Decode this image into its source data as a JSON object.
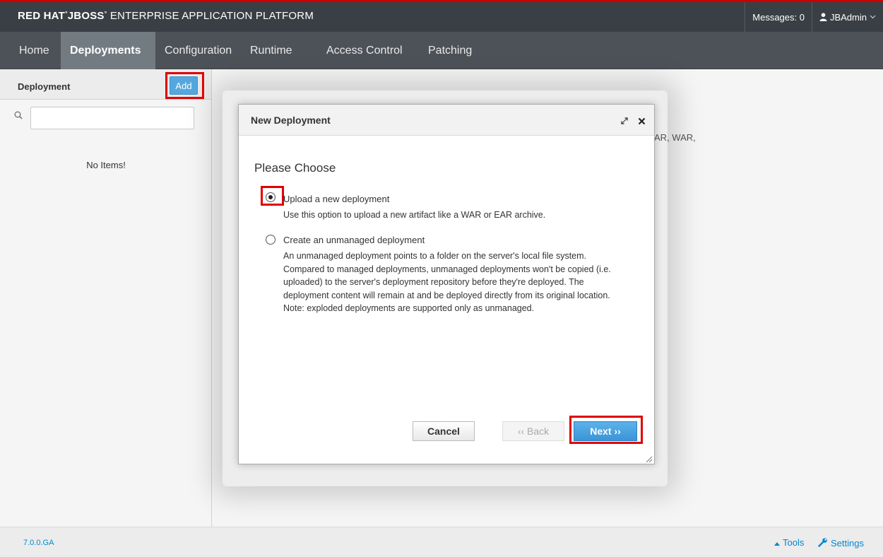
{
  "header": {
    "brand_part1": "RED HAT",
    "brand_part2": "JBOSS",
    "brand_part3": "ENTERPRISE APPLICATION PLATFORM",
    "messages": "Messages: 0",
    "user": "JBAdmin",
    "user_icon": "user-icon",
    "brand_color": "#cc0000"
  },
  "nav": {
    "tabs": [
      {
        "label": "Home",
        "active": false
      },
      {
        "label": "Deployments",
        "active": true
      },
      {
        "label": "Configuration",
        "active": false
      },
      {
        "label": "Runtime",
        "active": false
      },
      {
        "label": "Access Control",
        "active": false
      },
      {
        "label": "Patching",
        "active": false
      }
    ]
  },
  "sidebar": {
    "title": "Deployment",
    "add_label": "Add",
    "search_value": "",
    "empty_text": "No Items!"
  },
  "content": {
    "partial_text_1": "AR, WAR,",
    "partial_text_2": "."
  },
  "modal": {
    "title": "New Deployment",
    "heading": "Please Choose",
    "options": [
      {
        "label": "Upload a new deployment",
        "description": "Use this option to upload a new artifact like a WAR or EAR archive.",
        "selected": true
      },
      {
        "label": "Create an unmanaged deployment",
        "description": "An unmanaged deployment points to a folder on the server's local file system. Compared to managed deployments, unmanaged deployments won't be copied (i.e. uploaded) to the server's deployment repository before they're deployed. The deployment content will remain at and be deployed directly from its original location. Note: exploded deployments are supported only as unmanaged.",
        "selected": false
      }
    ],
    "buttons": {
      "cancel": "Cancel",
      "back": "‹‹ Back",
      "next": "Next ››"
    }
  },
  "footer": {
    "version": "7.0.0.GA",
    "tools": "Tools",
    "settings": "Settings"
  },
  "colors": {
    "accent": "#55a8df",
    "link": "#0088ce",
    "highlight": "#e00000"
  }
}
